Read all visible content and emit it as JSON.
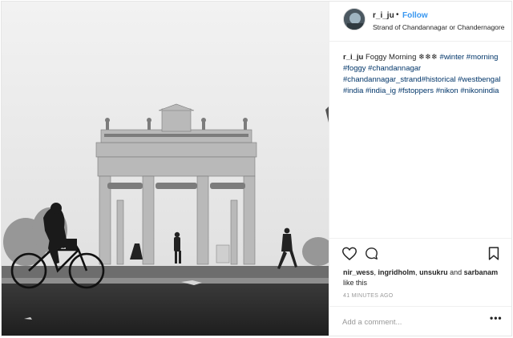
{
  "post": {
    "username": "r_i_ju",
    "separator": "•",
    "follow_label": "Follow",
    "location": "Strand of Chandannagar or Chandernagore",
    "caption": {
      "author": "r_i_ju",
      "text": "Foggy Morning ❄❄❄",
      "hashtags": [
        "#winter",
        "#morning",
        "#foggy",
        "#chandannagar",
        "#chandannagar_strand#historical",
        "#westbengal",
        "#india",
        "#india_ig",
        "#fstoppers",
        "#nikon",
        "#nikonindia"
      ]
    },
    "likes": {
      "names": [
        "nir_wess",
        "ingridholm",
        "unsukru"
      ],
      "last_name": "sarbanam",
      "and_label": "and",
      "suffix": "like this"
    },
    "time_ago": "41 MINUTES AGO",
    "comment_placeholder": "Add a comment...",
    "more_label": "•••"
  },
  "icons": {
    "like": "heart-icon",
    "comment": "comment-bubble-icon",
    "save": "bookmark-icon",
    "options": "more-options-icon"
  },
  "colors": {
    "link_blue": "#3897f0",
    "hashtag": "#003569",
    "muted": "#999999",
    "text": "#262626"
  }
}
